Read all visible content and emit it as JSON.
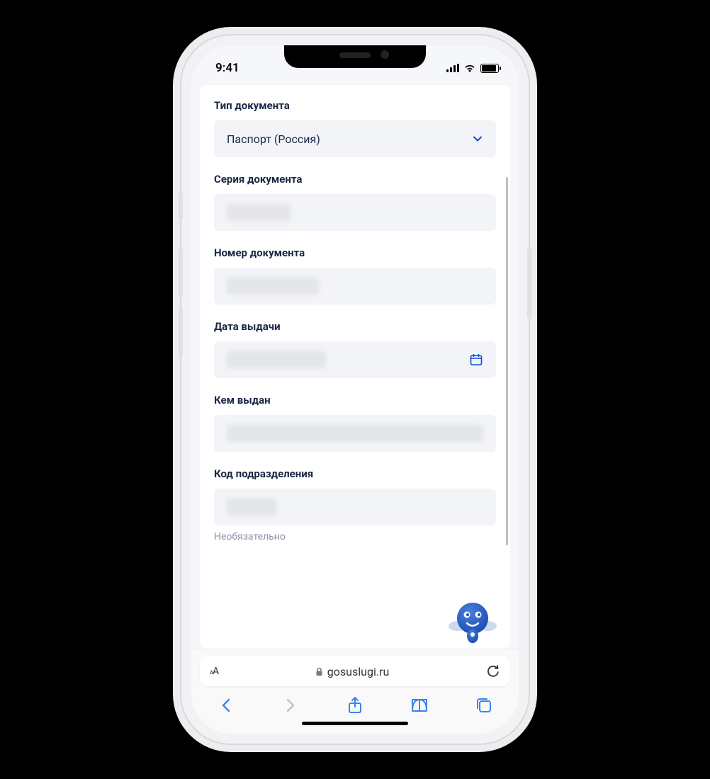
{
  "status": {
    "time": "9:41"
  },
  "form": {
    "doc_type": {
      "label": "Тип документа",
      "value": "Паспорт (Россия)"
    },
    "doc_series": {
      "label": "Серия документа"
    },
    "doc_number": {
      "label": "Номер документа"
    },
    "issue_date": {
      "label": "Дата выдачи"
    },
    "issued_by": {
      "label": "Кем выдан"
    },
    "dept_code": {
      "label": "Код подразделения",
      "hint": "Необязательно"
    }
  },
  "browser": {
    "aa": "ᴀA",
    "domain": "gosuslugi.ru"
  }
}
